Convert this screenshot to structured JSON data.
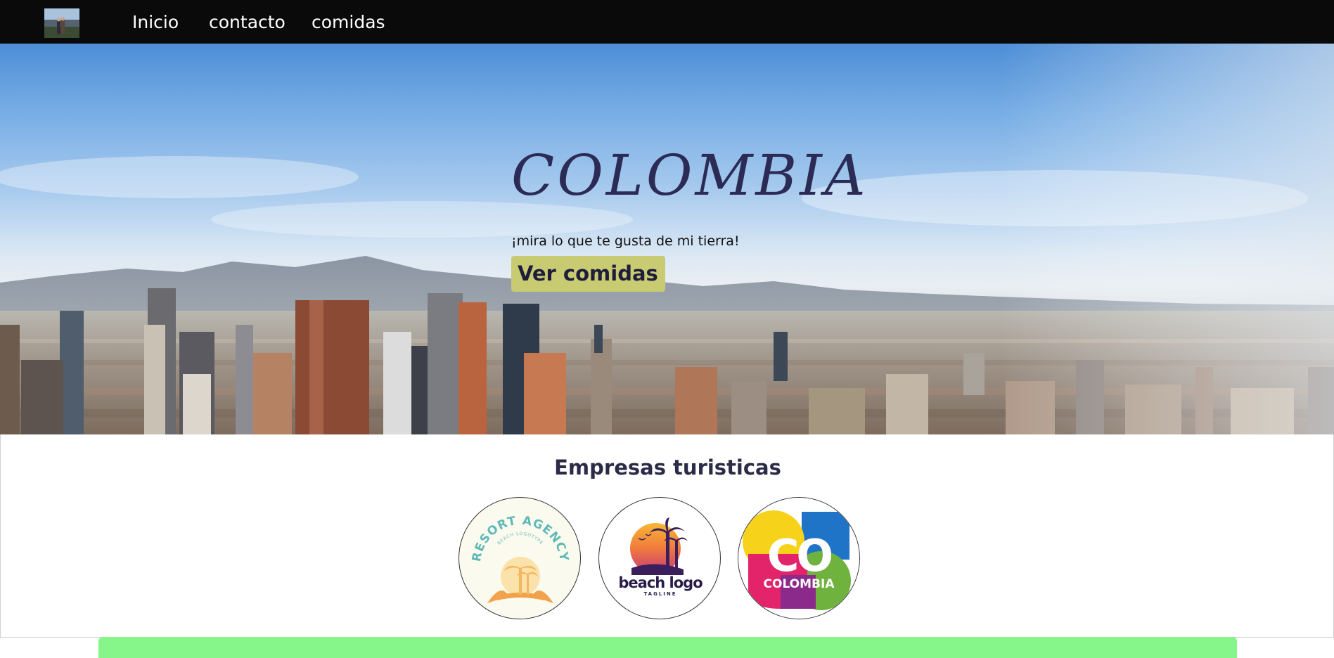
{
  "nav": {
    "logo_alt": "logo",
    "links": [
      "Inicio",
      "contacto",
      "comidas"
    ]
  },
  "hero": {
    "title": "COLOMBIA",
    "subtitle": "¡mira lo que te gusta de mi tierra!",
    "button_label": "Ver comidas"
  },
  "companies": {
    "title": "Empresas turisticas",
    "logos": [
      {
        "name": "resort-agency-logo",
        "text_main": "RESORT AGENCY",
        "text_sub": "BEACH LOGOTYPE"
      },
      {
        "name": "beach-logo",
        "text_main": "beach logo",
        "text_sub": "TAGLINE"
      },
      {
        "name": "colombia-co-logo",
        "text_main": "CO",
        "text_sub": "COLOMBIA"
      }
    ]
  },
  "colors": {
    "navbar": "#0a0a0a",
    "button": "#c9cb72",
    "title": "#2b2b55",
    "bottom_bar": "#86f58a"
  }
}
